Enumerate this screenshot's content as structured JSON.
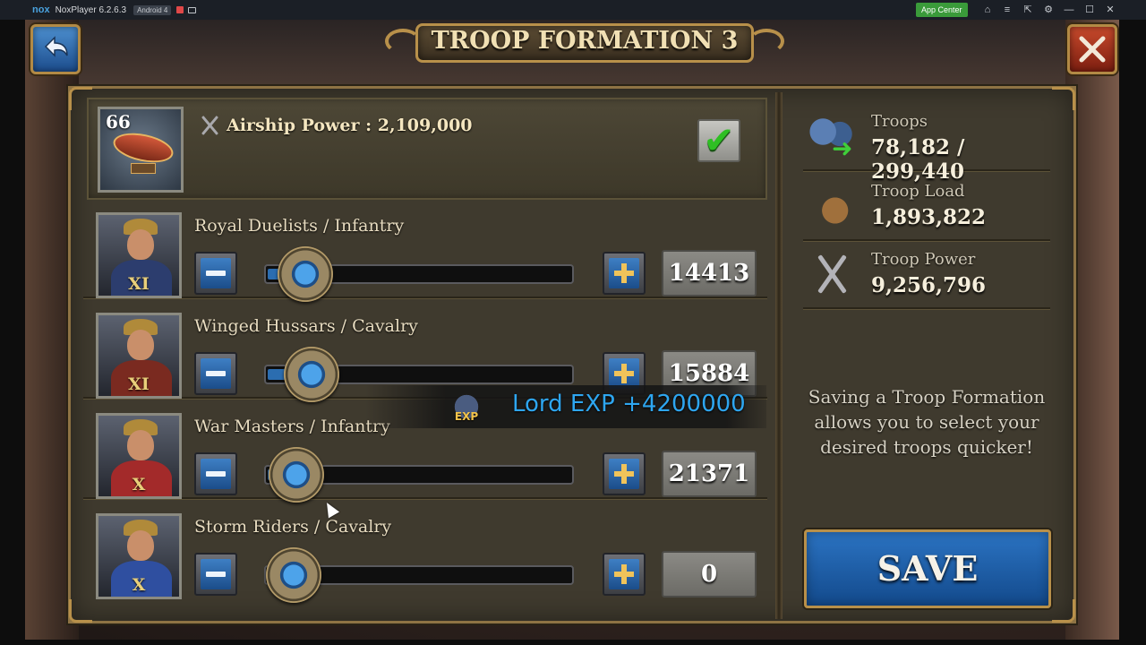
{
  "emulator": {
    "logo": "nox",
    "title": "NoxPlayer 6.2.6.3",
    "android_badge": "Android 4",
    "app_center": "App Center",
    "controls": [
      "shirt-icon",
      "menu-icon",
      "pin-icon",
      "gear-icon",
      "minimize-icon",
      "maximize-icon",
      "close-icon"
    ]
  },
  "game": {
    "title": "TROOP FORMATION 3",
    "back_icon": "back-arrow-icon",
    "close_label": "X",
    "airship": {
      "level": "66",
      "power_label": "Airship Power : 2,109,000",
      "selected": true
    },
    "troops": [
      {
        "name": "Royal Duelists / Infantry",
        "rank": "XI",
        "quantity": "14413",
        "fill_fraction": 0.13,
        "color": "#2c3d6e"
      },
      {
        "name": "Winged Hussars / Cavalry",
        "rank": "XI",
        "quantity": "15884",
        "fill_fraction": 0.15,
        "color": "#7a2a20"
      },
      {
        "name": "War Masters / Infantry",
        "rank": "X",
        "quantity": "21371",
        "fill_fraction": 0.1,
        "color": "#a32a2a"
      },
      {
        "name": "Storm Riders / Cavalry",
        "rank": "X",
        "quantity": "0",
        "fill_fraction": 0.02,
        "color": "#2f4fa0"
      }
    ],
    "stats": {
      "troops_label": "Troops",
      "troops_value": "78,182 / 299,440",
      "load_label": "Troop Load",
      "load_value": "1,893,822",
      "power_label": "Troop Power",
      "power_value": "9,256,796"
    },
    "hint": "Saving a Troop Formation allows you to select your desired troops quicker!",
    "save_label": "SAVE",
    "exp_toast": {
      "badge": "EXP",
      "text": "Lord EXP +4200000"
    }
  }
}
